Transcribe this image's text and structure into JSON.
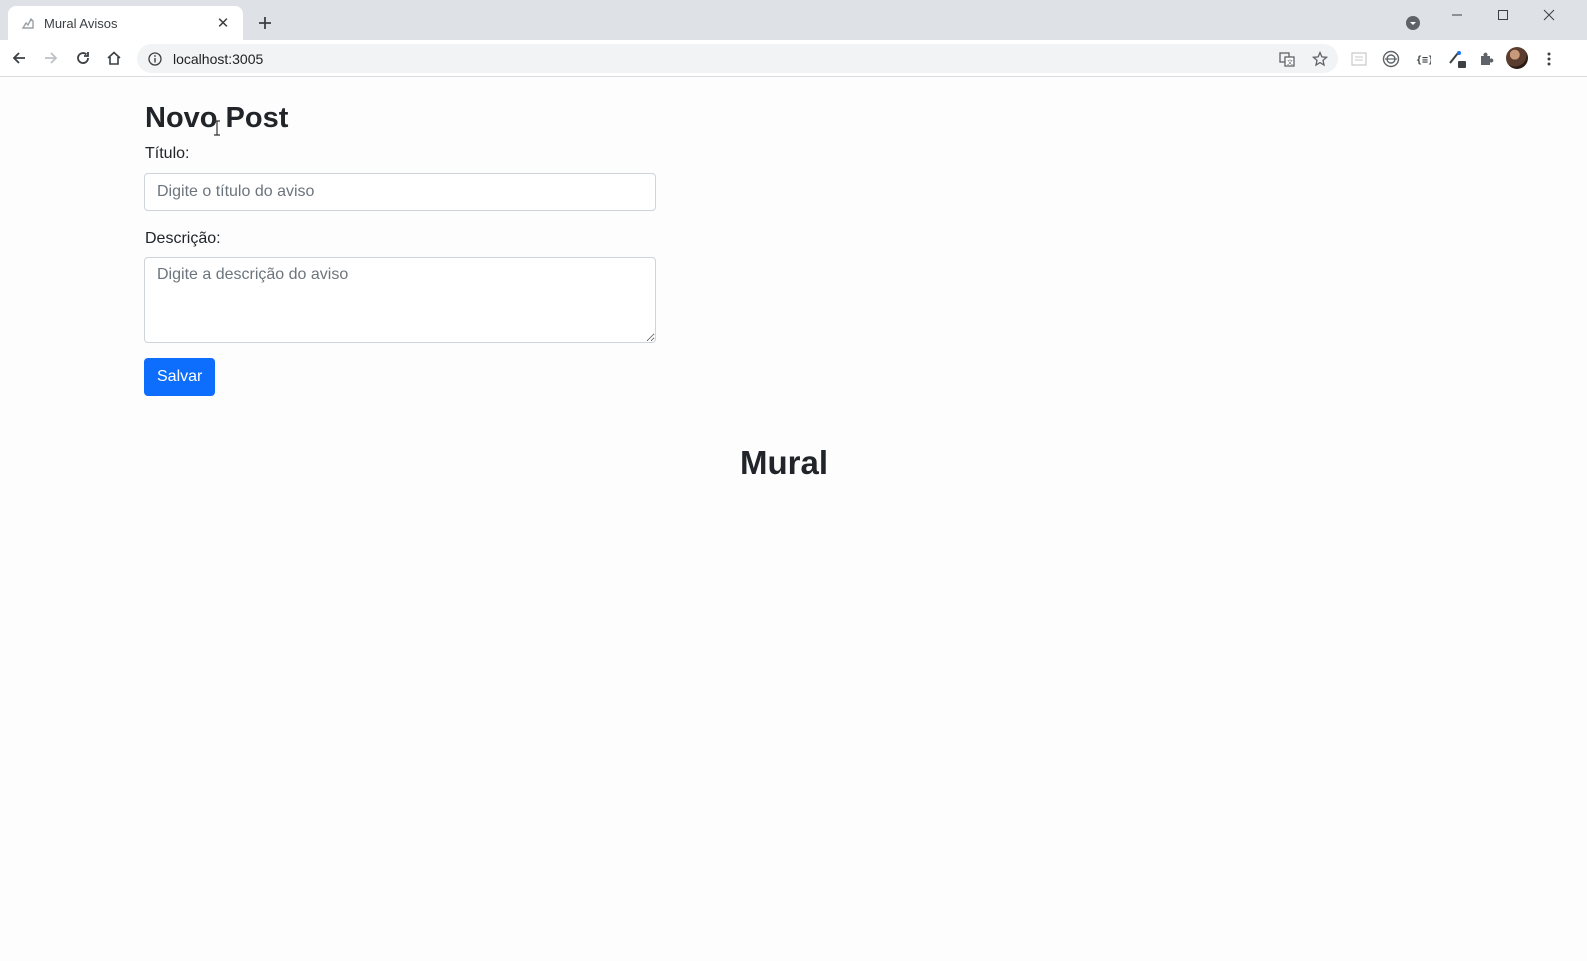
{
  "browser": {
    "tab": {
      "title": "Mural Avisos",
      "close_glyph": "✕",
      "favicon": "rocket-icon"
    },
    "new_tab_glyph": "+",
    "window_controls": {
      "minimize": "–",
      "maximize": "☐",
      "close": "✕"
    },
    "address_bar": {
      "url": "localhost:3005"
    },
    "extensions": [
      "translate-icon",
      "star-icon",
      "extension-a-icon",
      "extension-b-icon",
      "extension-c-icon",
      "extension-d-icon",
      "puzzle-icon"
    ]
  },
  "page": {
    "form_title": "Novo Post",
    "title_field": {
      "label": "Título:",
      "placeholder": "Digite o título do aviso",
      "value": ""
    },
    "description_field": {
      "label": "Descrição:",
      "placeholder": "Digite a descrição do aviso",
      "value": ""
    },
    "save_button": "Salvar",
    "mural_heading": "Mural"
  },
  "colors": {
    "primary": "#0d6efd",
    "text": "#212529",
    "placeholder": "#6c757d",
    "tabstrip": "#dee1e6",
    "omnibox": "#f1f3f4"
  }
}
